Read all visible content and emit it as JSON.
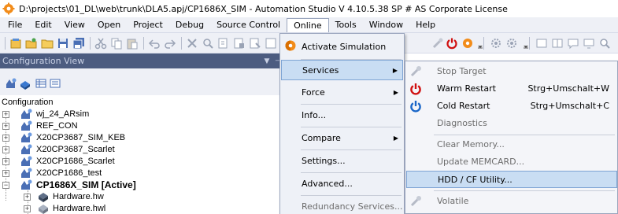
{
  "window": {
    "title": "D:\\projects\\01_DL\\web\\trunk\\DLA5.apj/CP1686X_SIM - Automation Studio V 4.10.5.38 SP # AS Corporate License"
  },
  "menubar": {
    "items": [
      "File",
      "Edit",
      "View",
      "Open",
      "Project",
      "Debug",
      "Source Control",
      "Online",
      "Tools",
      "Window",
      "Help"
    ],
    "open_item": "Online"
  },
  "panel": {
    "title": "Configuration View",
    "tree": {
      "root": "Configuration",
      "nodes": [
        {
          "label": "wj_24_ARsim",
          "expander": "+",
          "bold": false
        },
        {
          "label": "REF_CON",
          "expander": "+",
          "bold": false
        },
        {
          "label": "X20CP3687_SIM_KEB",
          "expander": "+",
          "bold": false
        },
        {
          "label": "X20CP3687_Scarlet",
          "expander": "+",
          "bold": false
        },
        {
          "label": "X20CP1686_Scarlet",
          "expander": "+",
          "bold": false
        },
        {
          "label": "X20CP1686_test",
          "expander": "+",
          "bold": false
        },
        {
          "label": "CP1686X_SIM [Active]",
          "expander": "−",
          "bold": true
        }
      ],
      "children": [
        {
          "label": "Hardware.hw"
        },
        {
          "label": "Hardware.hwl"
        }
      ]
    }
  },
  "online_menu": {
    "items": [
      {
        "label": "Activate Simulation",
        "icon": "simulation-icon",
        "submenu": false
      },
      {
        "label": "Services",
        "icon": "",
        "submenu": true,
        "highlighted": true
      },
      {
        "label": "Force",
        "icon": "",
        "submenu": true
      },
      {
        "label": "Info...",
        "icon": "",
        "submenu": false
      },
      {
        "label": "Compare",
        "icon": "",
        "submenu": true
      },
      {
        "label": "Settings...",
        "icon": "",
        "submenu": false
      },
      {
        "label": "Advanced...",
        "icon": "",
        "submenu": false
      },
      {
        "label": "Redundancy Services...",
        "icon": "",
        "submenu": false,
        "disabled": true
      }
    ]
  },
  "services_submenu": {
    "items": [
      {
        "label": "Stop Target",
        "shortcut": "",
        "icon": "stop-target-icon",
        "disabled": true
      },
      {
        "label": "Warm Restart",
        "shortcut": "Strg+Umschalt+W",
        "icon": "warm-restart-icon",
        "disabled": false
      },
      {
        "label": "Cold Restart",
        "shortcut": "Strg+Umschalt+C",
        "icon": "cold-restart-icon",
        "disabled": false
      },
      {
        "label": "Diagnostics",
        "shortcut": "",
        "icon": "",
        "disabled": true
      },
      {
        "label": "Clear Memory...",
        "shortcut": "",
        "icon": "",
        "disabled": true
      },
      {
        "label": "Update MEMCARD...",
        "shortcut": "",
        "icon": "",
        "disabled": true
      },
      {
        "label": "HDD / CF Utility...",
        "shortcut": "",
        "icon": "",
        "disabled": false,
        "highlighted": true
      },
      {
        "label": "Volatile",
        "shortcut": "",
        "icon": "volatile-icon",
        "disabled": true
      }
    ]
  },
  "colors": {
    "menubar_bg": "#eef0f6",
    "panel_header_bg": "#4c5c80",
    "highlight_bg": "#c9ddf3",
    "highlight_border": "#7ea4d4",
    "warm_restart_red": "#d01010",
    "cold_restart_blue": "#1a66c8"
  }
}
